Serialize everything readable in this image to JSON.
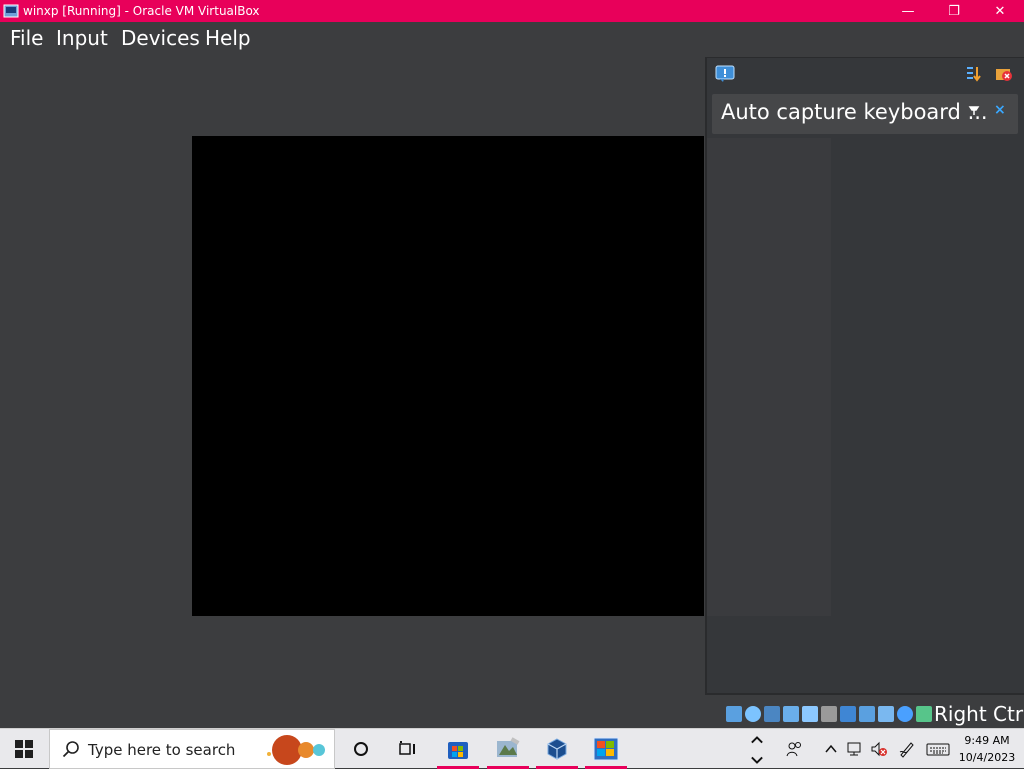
{
  "window": {
    "title": "winxp [Running] - Oracle VM VirtualBox",
    "minimize_glyph": "—",
    "maximize_glyph": "❐",
    "close_glyph": "✕",
    "accent_color": "#e8005a"
  },
  "menu": [
    "File",
    "Input",
    "Devices",
    "Help"
  ],
  "notification": {
    "message": "Auto capture keyboard ...",
    "close_glyph": "×"
  },
  "statusbar": {
    "icons": [
      "hard-disk-icon",
      "optical-drive-icon",
      "audio-icon",
      "network-icon",
      "usb-icon",
      "shared-folders-icon",
      "display-icon",
      "recording-icon",
      "video-capture-icon",
      "cpu-icon",
      "mouse-integration-icon",
      "keyboard-capture-icon"
    ],
    "host_key": "Right Ctrl"
  },
  "taskbar": {
    "search_placeholder": "Type here to search",
    "apps": [
      "store-app-icon",
      "paint-app-icon",
      "virtualbox-app-icon",
      "windows-xp-vm-app-icon"
    ],
    "time": "9:49 AM",
    "date": "10/4/2023"
  }
}
